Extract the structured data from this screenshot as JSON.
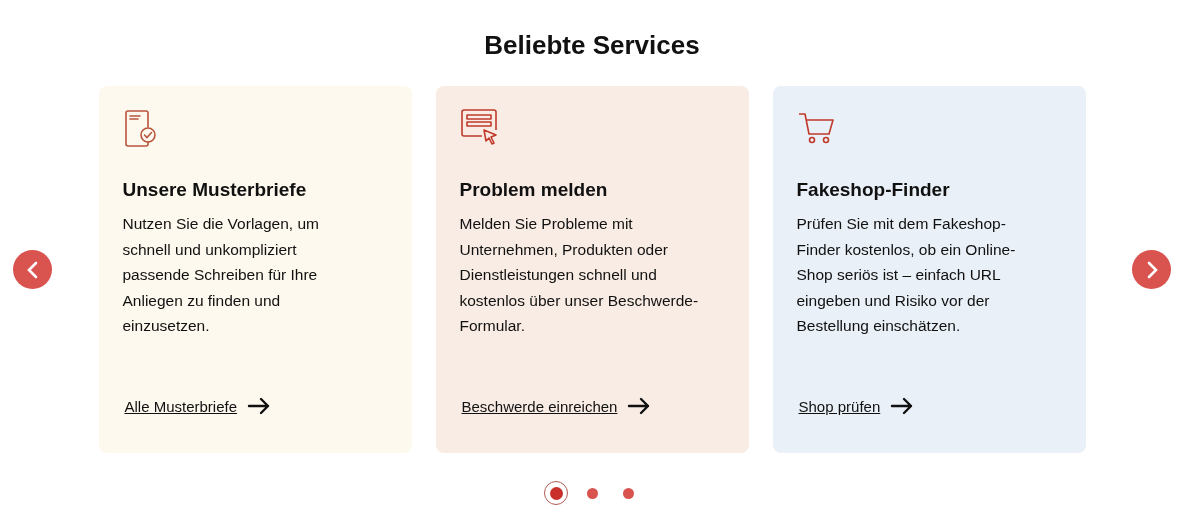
{
  "title": "Beliebte Services",
  "cards": [
    {
      "kind": "document",
      "color": "#fef9ee",
      "heading": "Unsere Musterbriefe",
      "text": "Nutzen Sie die Vorlagen, um schnell und unkompliziert passende Schreiben für Ihre Anliegen zu finden und einzusetzen.",
      "link": "Alle Musterbriefe"
    },
    {
      "kind": "form",
      "color": "#f9ece4",
      "heading": "Problem melden",
      "text": "Melden Sie Probleme mit Unternehmen, Produkten oder Dienstleistungen schnell und kostenlos über unser Beschwerde-Formular.",
      "link": "Beschwerde einreichen"
    },
    {
      "kind": "cart",
      "color": "#e9f0f7",
      "heading": "Fakeshop-Finder",
      "text": "Prüfen Sie mit dem Fakeshop-Finder kostenlos, ob ein Online-Shop seriös ist – einfach URL eingeben und Risiko vor der Bestellung einschätzen.",
      "link": "Shop prüfen"
    }
  ],
  "dots": [
    {
      "selected": true
    },
    {
      "selected": false
    },
    {
      "selected": false
    }
  ]
}
